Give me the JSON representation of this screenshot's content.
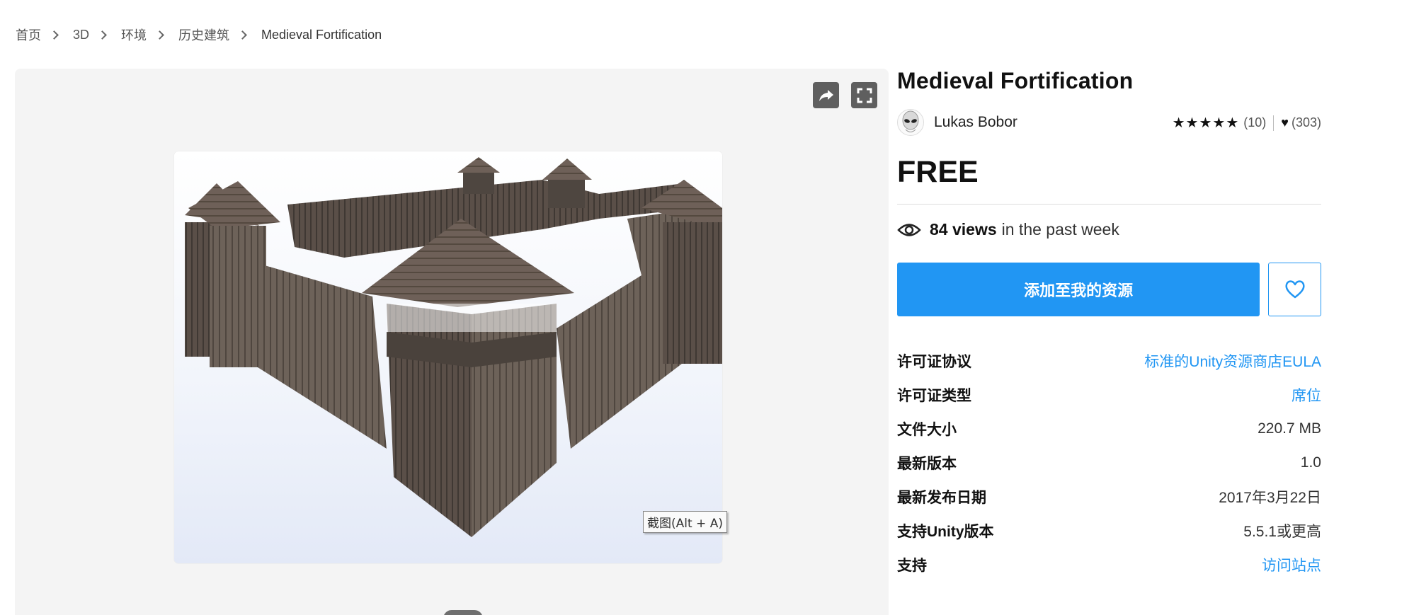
{
  "breadcrumb": [
    "首页",
    "3D",
    "环境",
    "历史建筑",
    "Medieval Fortification"
  ],
  "viewer": {
    "share_icon": "share-arrow-icon",
    "fullscreen_icon": "fullscreen-icon",
    "tooltip": "截图(Alt + A)"
  },
  "product": {
    "title": "Medieval Fortification",
    "author": "Lukas Bobor",
    "rating_stars": "★★★★★",
    "rating_value": 5,
    "rating_count": "(10)",
    "favorites_count": "(303)",
    "price": "FREE",
    "views_count": "84 views",
    "views_suffix": "in the past week",
    "add_button": "添加至我的资源"
  },
  "info": [
    {
      "key": "许可证协议",
      "value": "标准的Unity资源商店EULA",
      "link": true
    },
    {
      "key": "许可证类型",
      "value": "席位",
      "link": true
    },
    {
      "key": "文件大小",
      "value": "220.7 MB",
      "link": false
    },
    {
      "key": "最新版本",
      "value": "1.0",
      "link": false
    },
    {
      "key": "最新发布日期",
      "value": "2017年3月22日",
      "link": false
    },
    {
      "key": "支持Unity版本",
      "value": "5.5.1或更高",
      "link": false
    },
    {
      "key": "支持",
      "value": "访问站点",
      "link": true
    }
  ],
  "colors": {
    "accent": "#2196f3",
    "viewer_bg": "#f4f4f4"
  }
}
